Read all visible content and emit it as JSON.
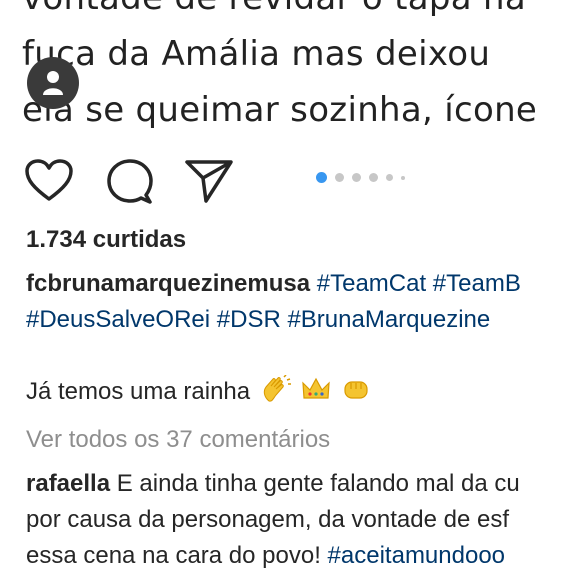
{
  "media": {
    "line1": "vontade de revidar o tapa na",
    "line2": "fuça da Amália mas deixou",
    "line3": "ela se queimar sozinha, ícone"
  },
  "actions": {
    "like": "heart-icon",
    "comment": "comment-icon",
    "share": "send-icon"
  },
  "carousel": {
    "total_dots": 6,
    "active_index": 0,
    "active_color": "#3897f0"
  },
  "likes": "1.734 curtidas",
  "caption": {
    "username": "fcbrunamarquezinemusa",
    "tags_line1": "#TeamCat #TeamB",
    "tags_line2": "#DeusSalveORei #DSR #BrunaMarquezine"
  },
  "comment1": {
    "text": "Já temos uma rainha"
  },
  "view_all": "Ver todos os 37 comentários",
  "comment2": {
    "username": "rafaella",
    "line1": "E ainda tinha gente falando mal da cu",
    "line2": "por causa da personagem, da vontade de esf",
    "line3_text": "essa cena na cara do povo!",
    "line3_tag": "#aceitamundooo"
  }
}
